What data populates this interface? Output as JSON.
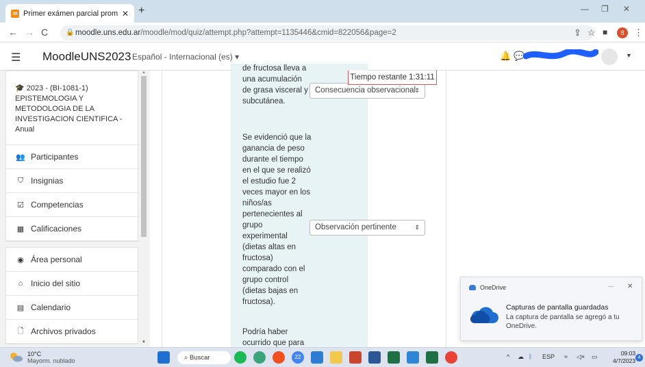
{
  "browser": {
    "tab_title": "Primer exámen parcial promoción",
    "tab_close": "✕",
    "new_tab": "+",
    "url_host": "moodle.uns.edu.ar",
    "url_path": "/moodle/mod/quiz/attempt.php?attempt=1135446&cmid=822056&page=2",
    "profile_letter": "8"
  },
  "moodle": {
    "site_name": "MoodleUNS2023",
    "language": "Español - Internacional (es) ▾"
  },
  "sidebar": {
    "course": "2023 - (BI-1081-1) EPISTEMOLOGIA Y METODOLOGIA DE LA INVESTIGACION CIENTIFICA - Anual",
    "items": [
      {
        "label": "Participantes",
        "icon": "users-icon"
      },
      {
        "label": "Insignias",
        "icon": "shield-icon"
      },
      {
        "label": "Competencias",
        "icon": "checkbox-icon"
      },
      {
        "label": "Calificaciones",
        "icon": "table-icon"
      }
    ],
    "items2": [
      {
        "label": "Área personal",
        "icon": "dashboard-icon"
      },
      {
        "label": "Inicio del sitio",
        "icon": "home-icon"
      },
      {
        "label": "Calendario",
        "icon": "calendar-icon"
      },
      {
        "label": "Archivos privados",
        "icon": "file-icon"
      }
    ]
  },
  "quiz": {
    "timer": "Tiempo restante 1:31:11",
    "q1_lines": [
      "de fructosa lleva a",
      "una acumulación",
      "de grasa visceral y",
      "subcutánea."
    ],
    "q1_answer": "Consecuencia observacional",
    "q2_lines": [
      "Se evidenció que la",
      "ganancia de peso",
      "durante el tiempo",
      "en el que se realizó",
      "el estudio fue 2",
      "veces mayor en los",
      "niños/as",
      "pertenecientes al",
      "grupo",
      "experimental",
      "(dietas altas en",
      "fructosa)",
      "comparado con el",
      "grupo control",
      "(dietas bajas en",
      "fructosa)."
    ],
    "q2_answer": "Observación pertinente",
    "q3_lines": [
      "Podría haber",
      "ocurrido que para"
    ]
  },
  "toast": {
    "app": "OneDrive",
    "more": "···",
    "close": "✕",
    "title": "Capturas de pantalla guardadas",
    "body": "La captura de pantalla se agregó a tu OneDrive."
  },
  "taskbar": {
    "temp": "10°C",
    "weather": "Mayorm. nublado",
    "search": "Buscar",
    "lang": "ESP",
    "time": "09:03",
    "date": "4/7/2023",
    "notif_count": "4",
    "chrome_badge": "22"
  }
}
